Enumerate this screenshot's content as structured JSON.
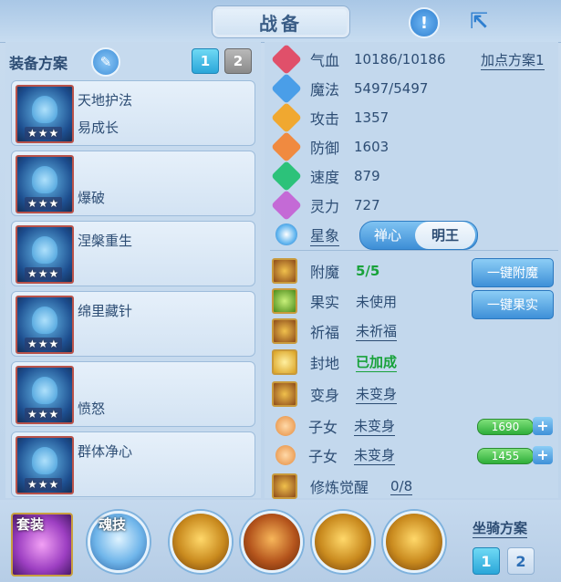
{
  "header": {
    "title": "战备",
    "help_icon": "exclamation-icon",
    "share_icon": "share-icon"
  },
  "equipment": {
    "scheme_label": "装备方案",
    "edit_icon": "pencil-icon",
    "tabs": [
      "1",
      "2"
    ],
    "items": [
      {
        "name": "天地护法",
        "sub": "易成长",
        "stars": "★★★"
      },
      {
        "name": "",
        "sub": "爆破",
        "stars": "★★★"
      },
      {
        "name": "涅槃重生",
        "sub": "",
        "stars": "★★★"
      },
      {
        "name": "绵里藏针",
        "sub": "",
        "stars": "★★★"
      },
      {
        "name": "",
        "sub": "愤怒",
        "stars": "★★★"
      },
      {
        "name": "群体净心",
        "sub": "",
        "stars": "★★★"
      }
    ]
  },
  "attributes": {
    "plan_link": "加点方案1",
    "stats": [
      {
        "name": "气血",
        "value": "10186/10186",
        "color": "#e0506a"
      },
      {
        "name": "魔法",
        "value": "5497/5497",
        "color": "#4a9ee8"
      },
      {
        "name": "攻击",
        "value": "1357",
        "color": "#f0a830"
      },
      {
        "name": "防御",
        "value": "1603",
        "color": "#f08a40"
      },
      {
        "name": "速度",
        "value": "879",
        "color": "#2cc27a"
      },
      {
        "name": "灵力",
        "value": "727",
        "color": "#c46ad6"
      }
    ],
    "star": {
      "label": "星象",
      "options": [
        "禅心",
        "明王"
      ],
      "selected": "明王"
    }
  },
  "cultivation": [
    {
      "name": "附魔",
      "value": "5/5",
      "style": "green"
    },
    {
      "name": "果实",
      "value": "未使用",
      "style": "plain"
    },
    {
      "name": "祈福",
      "value": "未祈福",
      "style": "underline"
    },
    {
      "name": "封地",
      "value": "已加成",
      "style": "green-underline"
    },
    {
      "name": "变身",
      "value": "未变身",
      "style": "underline"
    },
    {
      "name": "子女",
      "value": "未变身",
      "style": "underline"
    },
    {
      "name": "子女",
      "value": "未变身",
      "style": "underline"
    },
    {
      "name": "修炼觉醒",
      "value": "0/8",
      "style": "underline"
    }
  ],
  "actions": {
    "enchant": "一键附魔",
    "fruit": "一键果实"
  },
  "children_bars": [
    "1690",
    "1455"
  ],
  "bottom": {
    "suit_label": "套装",
    "soul_label": "魂技",
    "mount_label": "坐骑方案",
    "mount_tabs": [
      "1",
      "2"
    ]
  }
}
